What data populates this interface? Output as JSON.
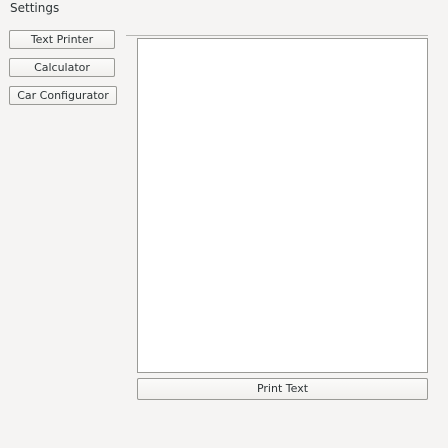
{
  "window": {
    "title": "Settings"
  },
  "sidebar": {
    "items": [
      {
        "label": "Text Printer"
      },
      {
        "label": "Calculator"
      },
      {
        "label": "Car Configurator"
      }
    ]
  },
  "main": {
    "output_text": "",
    "print_button_label": "Print Text"
  }
}
